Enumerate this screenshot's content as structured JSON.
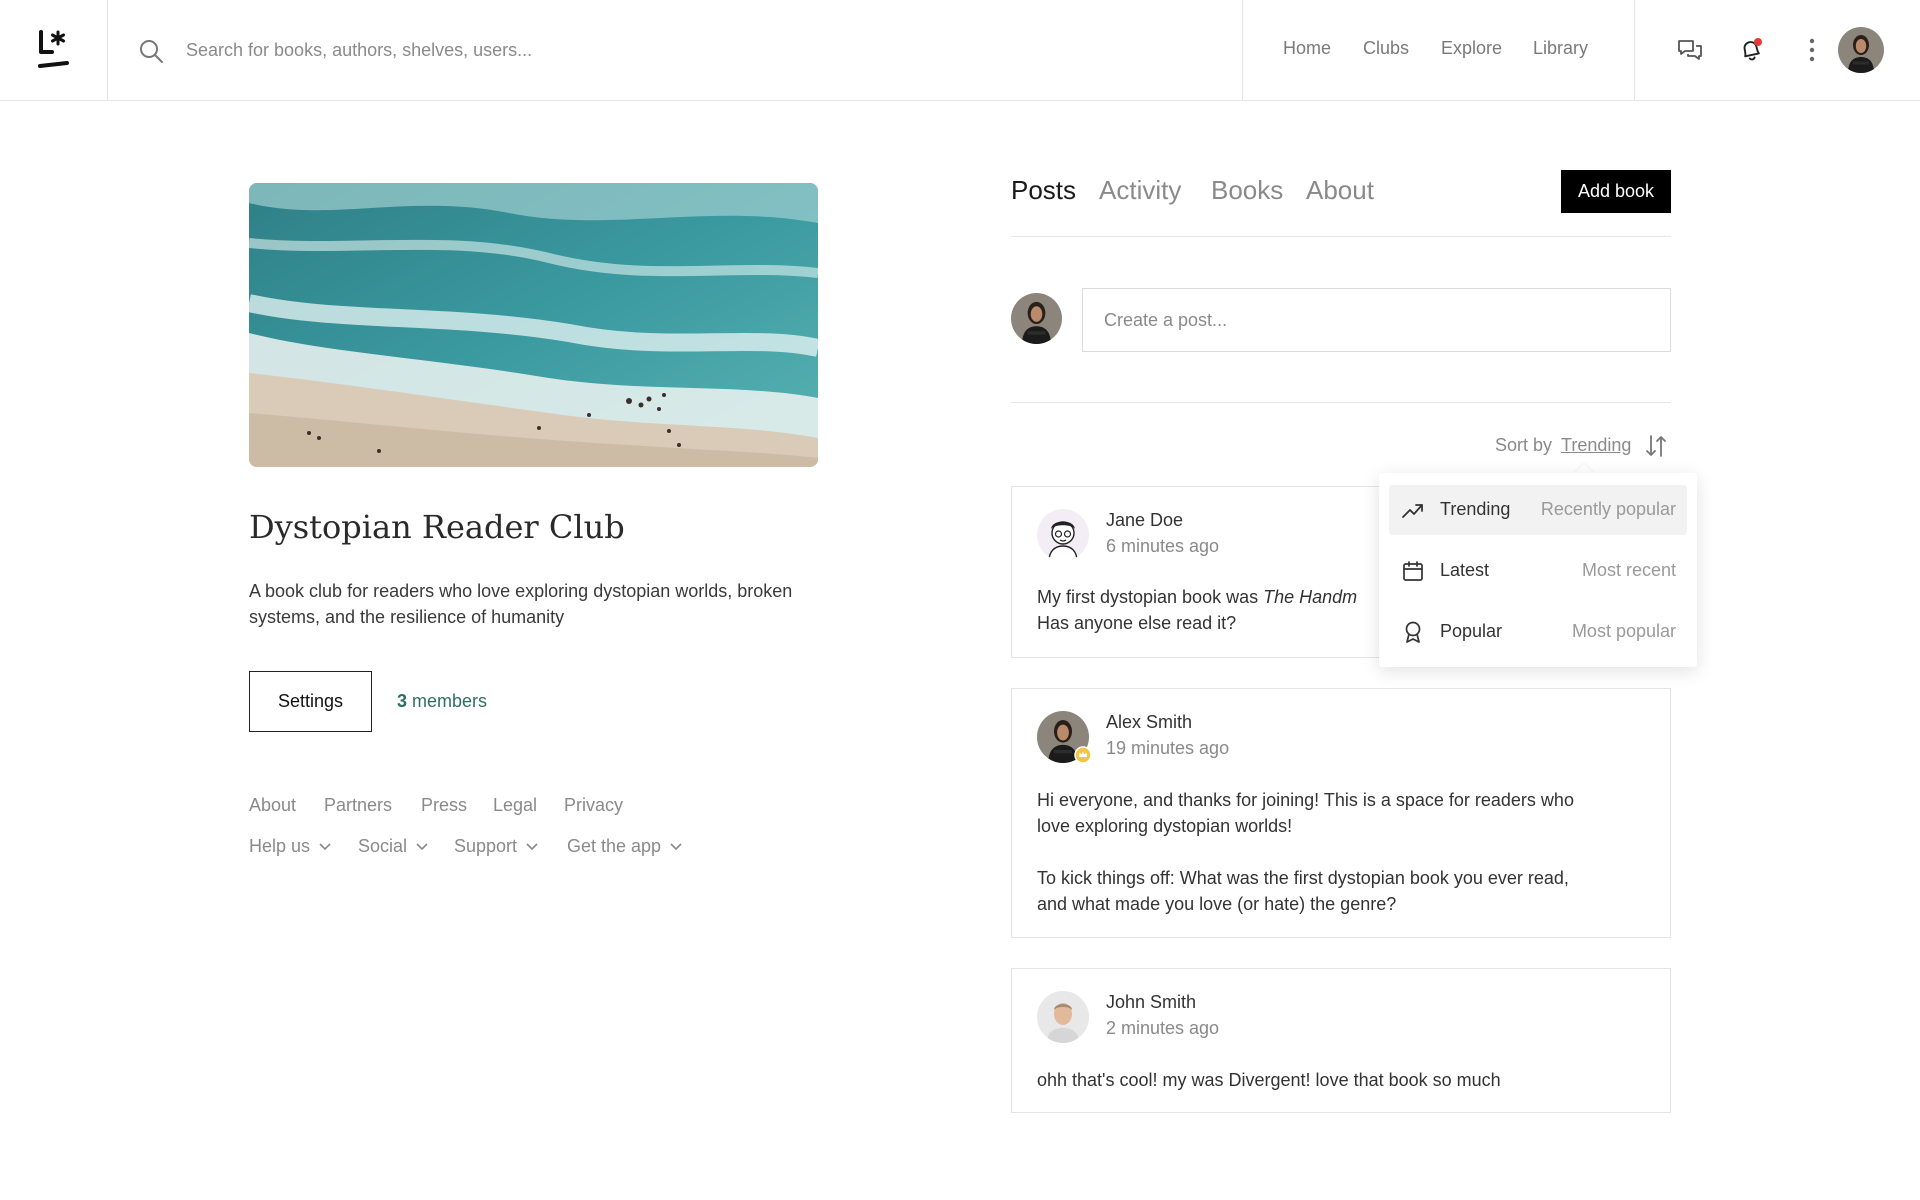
{
  "header": {
    "search_placeholder": "Search for books, authors, shelves, users...",
    "nav": [
      "Home",
      "Clubs",
      "Explore",
      "Library"
    ],
    "notification_dot_color": "#e53935"
  },
  "club": {
    "title": "Dystopian Reader Club",
    "description": "A book club for readers who love exploring dystopian worlds, broken systems, and the resilience of humanity",
    "settings_label": "Settings",
    "members_count": "3",
    "members_label": "members"
  },
  "footer": {
    "links": [
      "About",
      "Partners",
      "Press",
      "Legal",
      "Privacy"
    ],
    "dropdowns": [
      "Help us",
      "Social",
      "Support",
      "Get the app"
    ]
  },
  "tabs": [
    "Posts",
    "Activity",
    "Books",
    "About"
  ],
  "add_book_label": "Add book",
  "composer_placeholder": "Create a post...",
  "sort": {
    "label": "Sort by",
    "value": "Trending",
    "options": [
      {
        "label": "Trending",
        "hint": "Recently popular",
        "icon": "trending-up-icon"
      },
      {
        "label": "Latest",
        "hint": "Most recent",
        "icon": "calendar-icon"
      },
      {
        "label": "Popular",
        "hint": "Most popular",
        "icon": "award-icon"
      }
    ]
  },
  "posts": [
    {
      "name": "Jane Doe",
      "time": "6 minutes ago",
      "body_prefix": "My first dystopian book was ",
      "body_italic": "The Handm",
      "body_line2": "Has anyone else read it?"
    },
    {
      "name": "Alex Smith",
      "time": "19 minutes ago",
      "body_p1_l1": "Hi everyone, and thanks for joining! This is a space for readers who",
      "body_p1_l2": "love exploring dystopian worlds!",
      "body_p2_l1": "To kick things off: What was the first dystopian book you ever read,",
      "body_p2_l2": "and what made you love (or hate) the genre?"
    },
    {
      "name": "John Smith",
      "time": "2 minutes ago",
      "body": "ohh that's cool! my was Divergent! love that book so much"
    }
  ],
  "colors": {
    "accent_green": "#2f6f62",
    "primary_button": "#000000",
    "muted_text": "#8a8a8a"
  }
}
